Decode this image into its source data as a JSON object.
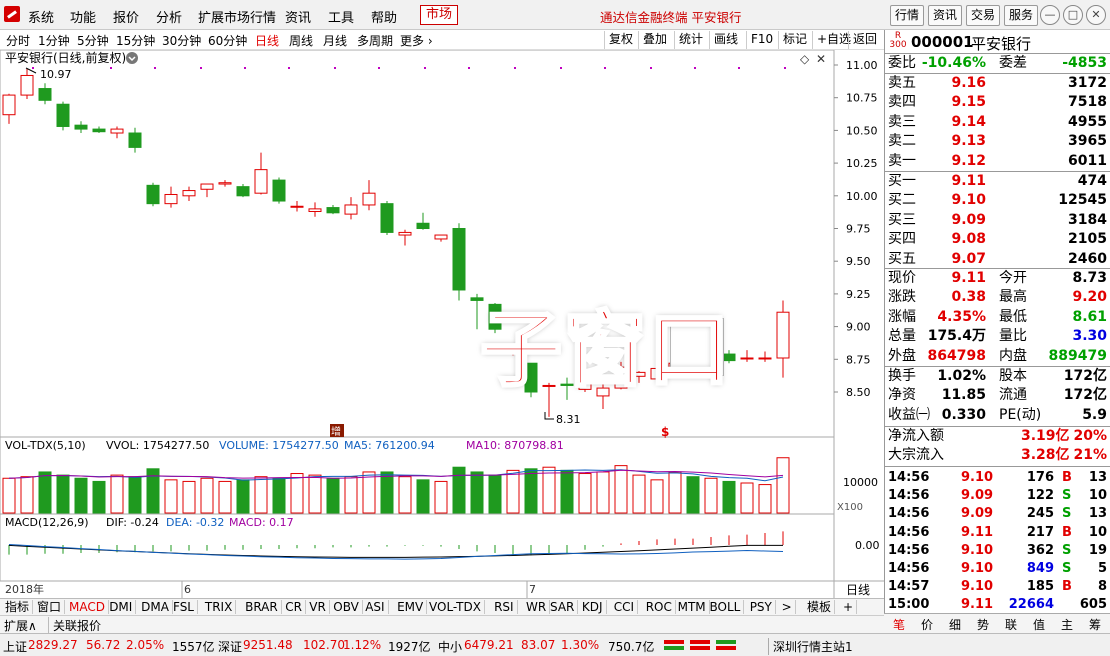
{
  "menubar": {
    "items": [
      "系统",
      "功能",
      "报价",
      "分析",
      "扩展市场行情",
      "资讯",
      "工具",
      "帮助"
    ],
    "market_label": "市场",
    "app_title": "通达信金融终端  平安银行",
    "right_buttons": [
      "行情",
      "资讯",
      "交易",
      "服务"
    ]
  },
  "periodbar": {
    "periods": [
      "分时",
      "1分钟",
      "5分钟",
      "15分钟",
      "30分钟",
      "60分钟",
      "日线",
      "周线",
      "月线",
      "多周期",
      "更多"
    ],
    "active_period": "日线",
    "tools": [
      "复权",
      "叠加",
      "统计",
      "画线",
      "F10",
      "标记",
      "+自选",
      "返回"
    ]
  },
  "chart": {
    "title": "平安银行(日线,前复权)",
    "high_mark": "10.97",
    "low_mark": "8.31",
    "price_ticks": [
      "11.00",
      "10.75",
      "10.50",
      "10.25",
      "10.00",
      "9.75",
      "9.50",
      "9.25",
      "9.00",
      "8.75",
      "8.50"
    ],
    "vol_title": "VOL-TDX(5,10)",
    "vol_label": "VVOL: 1754277.50",
    "vol_volume": "VOLUME: 1754277.50",
    "vol_ma5": "MA5: 761200.94",
    "vol_ma10": "MA10: 870798.81",
    "vol_tick": "10000",
    "vol_unit": "X100",
    "macd_title": "MACD(12,26,9)",
    "macd_dif": "DIF: -0.24",
    "macd_dea": "DEA: -0.32",
    "macd_val": "MACD: 0.17",
    "macd_tick": "0.00",
    "date_labels": [
      "2018年",
      "6",
      "7"
    ],
    "period_label": "日线",
    "marker_zeng": "增",
    "marker_s": "$",
    "overlay_text": "子窗口"
  },
  "chart_data": {
    "type": "candlestick",
    "title": "平安银行(日线,前复权)",
    "ylim": [
      8.2,
      11.1
    ],
    "candles": [
      {
        "o": 10.62,
        "h": 10.78,
        "l": 10.55,
        "c": 10.77
      },
      {
        "o": 10.77,
        "h": 10.97,
        "l": 10.74,
        "c": 10.92
      },
      {
        "o": 10.82,
        "h": 10.86,
        "l": 10.7,
        "c": 10.73
      },
      {
        "o": 10.7,
        "h": 10.72,
        "l": 10.5,
        "c": 10.53
      },
      {
        "o": 10.54,
        "h": 10.57,
        "l": 10.48,
        "c": 10.51
      },
      {
        "o": 10.51,
        "h": 10.53,
        "l": 10.48,
        "c": 10.49
      },
      {
        "o": 10.48,
        "h": 10.53,
        "l": 10.44,
        "c": 10.51
      },
      {
        "o": 10.48,
        "h": 10.52,
        "l": 10.33,
        "c": 10.37
      },
      {
        "o": 10.08,
        "h": 10.1,
        "l": 9.92,
        "c": 9.94
      },
      {
        "o": 9.94,
        "h": 10.07,
        "l": 9.91,
        "c": 10.01
      },
      {
        "o": 10.0,
        "h": 10.07,
        "l": 9.96,
        "c": 10.04
      },
      {
        "o": 10.05,
        "h": 10.09,
        "l": 9.99,
        "c": 10.09
      },
      {
        "o": 10.09,
        "h": 10.12,
        "l": 10.07,
        "c": 10.1
      },
      {
        "o": 10.07,
        "h": 10.09,
        "l": 9.99,
        "c": 10.0
      },
      {
        "o": 10.02,
        "h": 10.33,
        "l": 10.01,
        "c": 10.2
      },
      {
        "o": 10.12,
        "h": 10.14,
        "l": 9.94,
        "c": 9.96
      },
      {
        "o": 9.92,
        "h": 9.96,
        "l": 9.88,
        "c": 9.92
      },
      {
        "o": 9.88,
        "h": 9.95,
        "l": 9.84,
        "c": 9.9
      },
      {
        "o": 9.91,
        "h": 9.93,
        "l": 9.86,
        "c": 9.87
      },
      {
        "o": 9.86,
        "h": 9.99,
        "l": 9.82,
        "c": 9.93
      },
      {
        "o": 9.93,
        "h": 10.12,
        "l": 9.89,
        "c": 10.02
      },
      {
        "o": 9.94,
        "h": 9.96,
        "l": 9.7,
        "c": 9.72
      },
      {
        "o": 9.7,
        "h": 9.74,
        "l": 9.62,
        "c": 9.72
      },
      {
        "o": 9.79,
        "h": 9.87,
        "l": 9.74,
        "c": 9.75
      },
      {
        "o": 9.67,
        "h": 9.7,
        "l": 9.65,
        "c": 9.7
      },
      {
        "o": 9.75,
        "h": 9.79,
        "l": 9.2,
        "c": 9.28
      },
      {
        "o": 9.22,
        "h": 9.25,
        "l": 8.98,
        "c": 9.2
      },
      {
        "o": 9.17,
        "h": 9.18,
        "l": 8.95,
        "c": 8.98
      },
      {
        "o": 8.81,
        "h": 8.85,
        "l": 8.78,
        "c": 8.81
      },
      {
        "o": 8.72,
        "h": 8.72,
        "l": 8.46,
        "c": 8.5
      },
      {
        "o": 8.55,
        "h": 8.57,
        "l": 8.31,
        "c": 8.55
      },
      {
        "o": 8.56,
        "h": 8.61,
        "l": 8.44,
        "c": 8.55
      },
      {
        "o": 8.52,
        "h": 8.57,
        "l": 8.5,
        "c": 8.57
      },
      {
        "o": 8.47,
        "h": 8.6,
        "l": 8.37,
        "c": 8.53
      },
      {
        "o": 8.53,
        "h": 8.73,
        "l": 8.52,
        "c": 8.69
      },
      {
        "o": 8.62,
        "h": 8.66,
        "l": 8.57,
        "c": 8.65
      },
      {
        "o": 8.6,
        "h": 8.71,
        "l": 8.6,
        "c": 8.68
      },
      {
        "o": 8.66,
        "h": 8.73,
        "l": 8.62,
        "c": 8.72
      },
      {
        "o": 8.75,
        "h": 8.78,
        "l": 8.65,
        "c": 8.73
      },
      {
        "o": 8.74,
        "h": 8.82,
        "l": 8.72,
        "c": 8.78
      },
      {
        "o": 8.79,
        "h": 8.82,
        "l": 8.72,
        "c": 8.74
      },
      {
        "o": 8.76,
        "h": 8.82,
        "l": 8.73,
        "c": 8.76
      },
      {
        "o": 8.76,
        "h": 8.81,
        "l": 8.73,
        "c": 8.76
      },
      {
        "o": 8.76,
        "h": 9.2,
        "l": 8.61,
        "c": 9.11
      }
    ],
    "volumes": [
      1100,
      1150,
      1300,
      1200,
      1100,
      1000,
      1200,
      1150,
      1400,
      1050,
      1000,
      1100,
      1000,
      1050,
      1150,
      1100,
      1250,
      1200,
      1100,
      1150,
      1300,
      1300,
      1150,
      1050,
      1000,
      1450,
      1300,
      1200,
      1350,
      1400,
      1450,
      1350,
      1250,
      1300,
      1500,
      1200,
      1050,
      1300,
      1150,
      1100,
      1000,
      950,
      900,
      1750
    ],
    "macd_hist": [
      -0.12,
      -0.12,
      -0.11,
      -0.11,
      -0.1,
      -0.1,
      -0.09,
      -0.09,
      -0.08,
      -0.08,
      -0.07,
      -0.07,
      -0.06,
      -0.06,
      -0.05,
      -0.05,
      -0.04,
      -0.04,
      -0.03,
      -0.03,
      -0.02,
      -0.02,
      -0.01,
      -0.01,
      -0.02,
      -0.05,
      -0.08,
      -0.1,
      -0.12,
      -0.13,
      -0.12,
      -0.1,
      -0.06,
      -0.02,
      0.02,
      0.05,
      0.07,
      0.08,
      0.08,
      0.1,
      0.12,
      0.13,
      0.15,
      0.17
    ]
  },
  "bottom_tabs": [
    "指标",
    "窗口",
    "MACD",
    "DMI",
    "DMA",
    "FSL",
    "TRIX",
    "BRAR",
    "CR",
    "VR",
    "OBV",
    "ASI",
    "EMV",
    "VOL-TDX",
    "RSI",
    "WR",
    "SAR",
    "KDJ",
    "CCI",
    "ROC",
    "MTM",
    "BOLL",
    "PSY"
  ],
  "bottom_tabs_more": ">",
  "bottom_template": "模板",
  "bottom_plus": "+",
  "ext_bar": [
    "扩展∧",
    "关联报价"
  ],
  "quote": {
    "code": "000001",
    "name": "平安银行",
    "badge_r": "R",
    "badge_num": "300",
    "weibi_label": "委比",
    "weibi": "-10.46%",
    "weicha_label": "委差",
    "weicha": "-4853",
    "asks": [
      {
        "label": "卖五",
        "price": "9.16",
        "vol": "3172"
      },
      {
        "label": "卖四",
        "price": "9.15",
        "vol": "7518"
      },
      {
        "label": "卖三",
        "price": "9.14",
        "vol": "4955"
      },
      {
        "label": "卖二",
        "price": "9.13",
        "vol": "3965"
      },
      {
        "label": "卖一",
        "price": "9.12",
        "vol": "6011"
      }
    ],
    "bids": [
      {
        "label": "买一",
        "price": "9.11",
        "vol": "474"
      },
      {
        "label": "买二",
        "price": "9.10",
        "vol": "12545"
      },
      {
        "label": "买三",
        "price": "9.09",
        "vol": "3184"
      },
      {
        "label": "买四",
        "price": "9.08",
        "vol": "2105"
      },
      {
        "label": "买五",
        "price": "9.07",
        "vol": "2460"
      }
    ],
    "stats": [
      {
        "l1": "现价",
        "v1": "9.11",
        "c1": "red",
        "l2": "今开",
        "v2": "8.73",
        "c2": "black"
      },
      {
        "l1": "涨跌",
        "v1": "0.38",
        "c1": "red",
        "l2": "最高",
        "v2": "9.20",
        "c2": "red"
      },
      {
        "l1": "涨幅",
        "v1": "4.35%",
        "c1": "red",
        "l2": "最低",
        "v2": "8.61",
        "c2": "green"
      },
      {
        "l1": "总量",
        "v1": "175.4万",
        "c1": "black",
        "l2": "量比",
        "v2": "3.30",
        "c2": "blue"
      },
      {
        "l1": "外盘",
        "v1": "864798",
        "c1": "red",
        "l2": "内盘",
        "v2": "889479",
        "c2": "green"
      }
    ],
    "stats2": [
      {
        "l1": "换手",
        "v1": "1.02%",
        "l2": "股本",
        "v2": "172亿"
      },
      {
        "l1": "净资",
        "v1": "11.85",
        "l2": "流通",
        "v2": "172亿"
      },
      {
        "l1": "收益㈠",
        "v1": "0.330",
        "l2": "PE(动)",
        "v2": "5.9"
      }
    ],
    "flows": [
      {
        "label": "净流入额",
        "val": "3.19亿",
        "pct": "20%"
      },
      {
        "label": "大宗流入",
        "val": "3.28亿",
        "pct": "21%"
      }
    ],
    "ticks": [
      {
        "time": "14:56",
        "price": "9.10",
        "vol": "176",
        "vc": "black",
        "bs": "B",
        "bsc": "red",
        "n": "13"
      },
      {
        "time": "14:56",
        "price": "9.09",
        "vol": "122",
        "vc": "black",
        "bs": "S",
        "bsc": "green",
        "n": "10"
      },
      {
        "time": "14:56",
        "price": "9.09",
        "vol": "245",
        "vc": "black",
        "bs": "S",
        "bsc": "green",
        "n": "13"
      },
      {
        "time": "14:56",
        "price": "9.11",
        "vol": "217",
        "vc": "black",
        "bs": "B",
        "bsc": "red",
        "n": "10"
      },
      {
        "time": "14:56",
        "price": "9.10",
        "vol": "362",
        "vc": "black",
        "bs": "S",
        "bsc": "green",
        "n": "19"
      },
      {
        "time": "14:56",
        "price": "9.10",
        "vol": "849",
        "vc": "blue",
        "bs": "S",
        "bsc": "green",
        "n": "5"
      },
      {
        "time": "14:57",
        "price": "9.10",
        "vol": "185",
        "vc": "black",
        "bs": "B",
        "bsc": "red",
        "n": "8"
      },
      {
        "time": "15:00",
        "price": "9.11",
        "vol": "22664",
        "vc": "blue",
        "bs": "",
        "bsc": "black",
        "n": "605"
      }
    ],
    "tabs": [
      "笔",
      "价",
      "细",
      "势",
      "联",
      "值",
      "主",
      "筹"
    ]
  },
  "statusbar": {
    "sh_label": "上证",
    "sh_val": "2829.27",
    "sh_chg": "56.72",
    "sh_pct": "2.05%",
    "sh_amt": "1557亿",
    "sz_label": "深证",
    "sz_val": "9251.48",
    "sz_chg": "102.70",
    "sz_pct": "1.12%",
    "sz_amt": "1927亿",
    "zx_label": "中小",
    "zx_val": "6479.21",
    "zx_chg": "83.07",
    "zx_pct": "1.30%",
    "zx_amt": "750.7亿",
    "server": "深圳行情主站1"
  },
  "colors": {
    "up": "#e10000",
    "down": "#1f9a1f",
    "accent": "#c00000"
  }
}
